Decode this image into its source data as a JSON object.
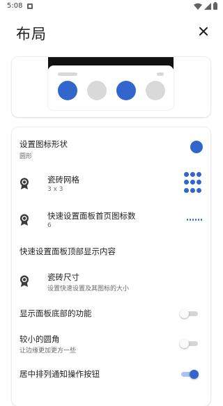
{
  "status_bar": {
    "time": "5:08",
    "icons": [
      "notification-icon",
      "wifi-icon",
      "cell-signal-icon",
      "battery-icon"
    ]
  },
  "header": {
    "title": "布局",
    "close_icon": "close-icon"
  },
  "preview": {
    "tile_colors": [
      "#3366cc",
      "#d9d9d9",
      "#3366cc",
      "#d9d9d9"
    ]
  },
  "settings": {
    "icon_shape": {
      "title": "设置图标形状",
      "value": "圆形"
    },
    "tile_grid": {
      "title": "瓷砖网格",
      "value": "3 x 3"
    },
    "qs_first_page_count": {
      "title": "快速设置面板首页图标数",
      "value": "6"
    },
    "qs_top_content": {
      "title": "快速设置面板顶部显示内容"
    },
    "tile_size": {
      "title": "瓷砖尺寸",
      "subtitle": "设置快速设置及其图标的大小"
    },
    "show_bottom_features": {
      "title": "显示面板底部的功能",
      "enabled": false
    },
    "smaller_corners": {
      "title": "较小的圆角",
      "subtitle": "让边缘更加更方一些",
      "enabled": false
    },
    "center_notification_buttons": {
      "title": "居中排列通知操作按钮",
      "enabled": true
    }
  },
  "colors": {
    "accent": "#3366cc",
    "inactive": "#d9d9d9"
  }
}
